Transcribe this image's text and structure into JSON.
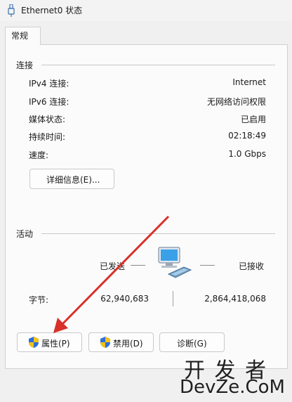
{
  "window": {
    "title": "Ethernet0 状态",
    "icon": "network-adapter-icon"
  },
  "tabs": [
    {
      "label": "常规"
    }
  ],
  "connection": {
    "heading": "连接",
    "rows": [
      {
        "label": "IPv4 连接:",
        "value": "Internet"
      },
      {
        "label": "IPv6 连接:",
        "value": "无网络访问权限"
      },
      {
        "label": "媒体状态:",
        "value": "已启用"
      },
      {
        "label": "持续时间:",
        "value": "02:18:49"
      },
      {
        "label": "速度:",
        "value": "1.0 Gbps"
      }
    ],
    "details_button": "详细信息(E)..."
  },
  "activity": {
    "heading": "活动",
    "sent_label": "已发送",
    "received_label": "已接收",
    "bytes_label": "字节:",
    "bytes_sent": "62,940,683",
    "bytes_received": "2,864,418,068",
    "icon": "network-computers-icon"
  },
  "buttons": {
    "properties": "属性(P)",
    "disable": "禁用(D)",
    "diagnose": "诊断(G)"
  },
  "watermark": {
    "line1": "开 发 者",
    "line2": "DevZe.CoM"
  },
  "colors": {
    "arrow": "#d9302a",
    "shield_blue": "#2f6fd6",
    "shield_yellow": "#f2c21b"
  }
}
